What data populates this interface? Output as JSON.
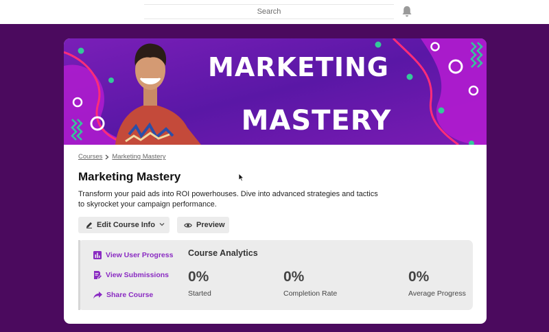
{
  "search": {
    "placeholder": "Search"
  },
  "banner": {
    "title_line1": "MARKETING",
    "title_line2": "MASTERY",
    "colors": {
      "purple": "#8e1fc6",
      "pink": "#d81e8f",
      "teal": "#34c89a",
      "red": "#ff3366"
    }
  },
  "breadcrumb": {
    "items": [
      "Courses",
      "Marketing Mastery"
    ]
  },
  "course": {
    "title": "Marketing Mastery",
    "description": "Transform your paid ads into ROI powerhouses. Dive into advanced strategies and tactics to skyrocket your campaign performance."
  },
  "actions": {
    "edit_label": "Edit Course Info",
    "preview_label": "Preview"
  },
  "links": [
    {
      "label": "View User Progress",
      "icon": "bar-chart-icon"
    },
    {
      "label": "View Submissions",
      "icon": "document-edit-icon"
    },
    {
      "label": "Share Course",
      "icon": "share-icon"
    }
  ],
  "analytics": {
    "title": "Course Analytics",
    "stats": [
      {
        "value": "0%",
        "label": "Started"
      },
      {
        "value": "0%",
        "label": "Completion Rate"
      },
      {
        "value": "0%",
        "label": "Average Progress"
      }
    ]
  },
  "colors": {
    "page_background": "#4b0a5e",
    "link_accent": "#8a2bc2"
  }
}
